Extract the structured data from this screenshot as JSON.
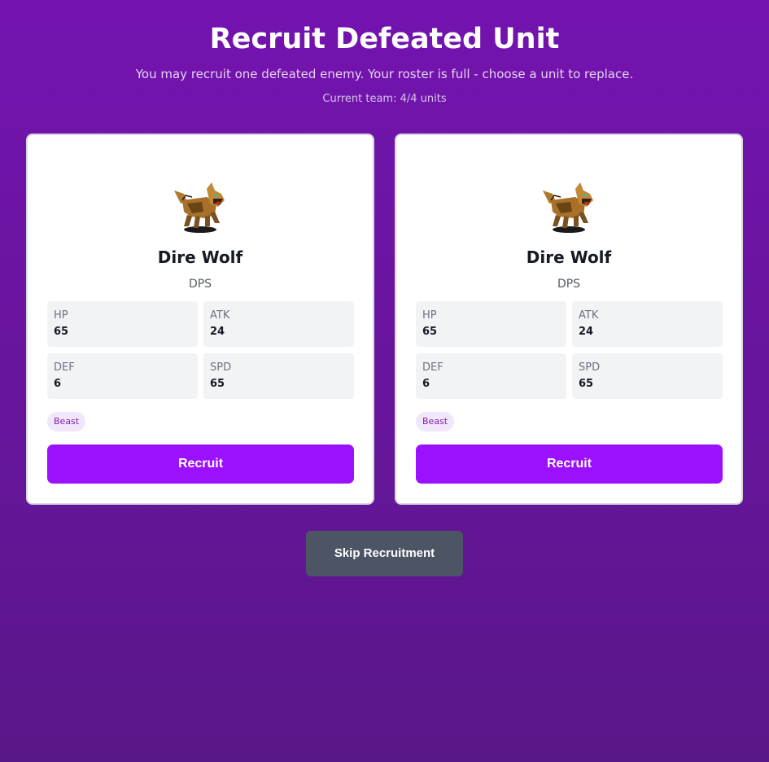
{
  "header": {
    "title": "Recruit Defeated Unit",
    "subtitle": "You may recruit one defeated enemy. Your roster is full - choose a unit to replace.",
    "team_count": "Current team: 4/4 units"
  },
  "units": [
    {
      "name": "Dire Wolf",
      "role": "DPS",
      "sprite": "wolf-sprite",
      "stats": {
        "hp_label": "HP",
        "hp": "65",
        "atk_label": "ATK",
        "atk": "24",
        "def_label": "DEF",
        "def": "6",
        "spd_label": "SPD",
        "spd": "65"
      },
      "tag": "Beast",
      "recruit_label": "Recruit"
    },
    {
      "name": "Dire Wolf",
      "role": "DPS",
      "sprite": "wolf-sprite",
      "stats": {
        "hp_label": "HP",
        "hp": "65",
        "atk_label": "ATK",
        "atk": "24",
        "def_label": "DEF",
        "def": "6",
        "spd_label": "SPD",
        "spd": "65"
      },
      "tag": "Beast",
      "recruit_label": "Recruit"
    }
  ],
  "skip_label": "Skip Recruitment",
  "colors": {
    "background_top": "#7413b0",
    "background_bottom": "#5a1789",
    "recruit_button": "#9b10fd",
    "skip_button": "#4b5563",
    "tag_background": "#f2e6fb",
    "tag_text": "#7e22a8"
  }
}
